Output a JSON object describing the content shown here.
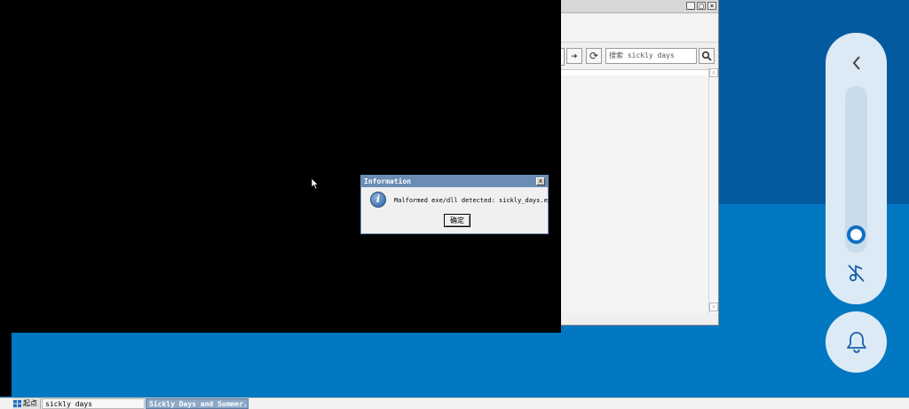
{
  "browser": {
    "search_placeholder": "搜索 sickly days",
    "forward_icon": "arrow-right",
    "refresh_icon": "refresh",
    "search_icon": "magnifier"
  },
  "dialog": {
    "title": "Information",
    "close_label": "x",
    "message": "Malformed exe/dll detected: sickly_days.exe",
    "ok_label": "确定"
  },
  "side_panel": {
    "back_icon": "chevron-left",
    "mute_icon": "music-off",
    "bell_icon": "bell",
    "volume_level": 0.0
  },
  "taskbar": {
    "start_label": "起点",
    "items": [
      {
        "label": "sickly days"
      },
      {
        "label": "Sickly Days and Summer..."
      }
    ]
  },
  "colors": {
    "desktop": "#0178c1",
    "accent": "#0f6fc6",
    "dialog_title": "#6b8db4"
  }
}
